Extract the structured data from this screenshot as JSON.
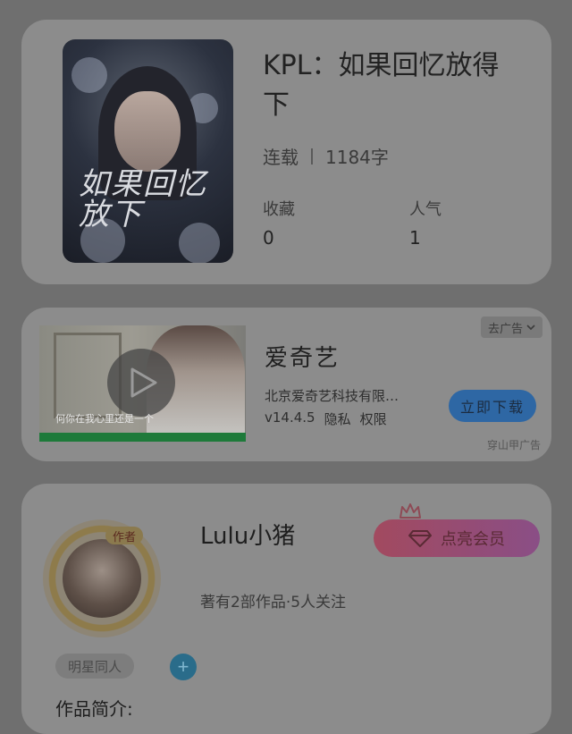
{
  "book": {
    "cover_title": "如果回忆放下",
    "title": "KPL：如果回忆放得下",
    "status": "连载",
    "word_count": "1184字",
    "stats": [
      {
        "label": "收藏",
        "value": "0"
      },
      {
        "label": "人气",
        "value": "1"
      }
    ]
  },
  "ad": {
    "thumb_subtitle": "何你在我心里还是一个",
    "badge_label": "去广告",
    "app_name": "爱奇艺",
    "company": "北京爱奇艺科技有限…",
    "version": "v14.4.5",
    "privacy_label": "隐私",
    "permissions_label": "权限",
    "download_label": "立即下载",
    "source_label": "穿山甲广告"
  },
  "author": {
    "avatar_tag": "作者",
    "name": "Lulu小猪",
    "stats_text": "著有2部作品·5人关注",
    "vip_label": "点亮会员",
    "tag_label": "明星同人",
    "add_symbol": "+",
    "intro_label": "作品简介:"
  }
}
